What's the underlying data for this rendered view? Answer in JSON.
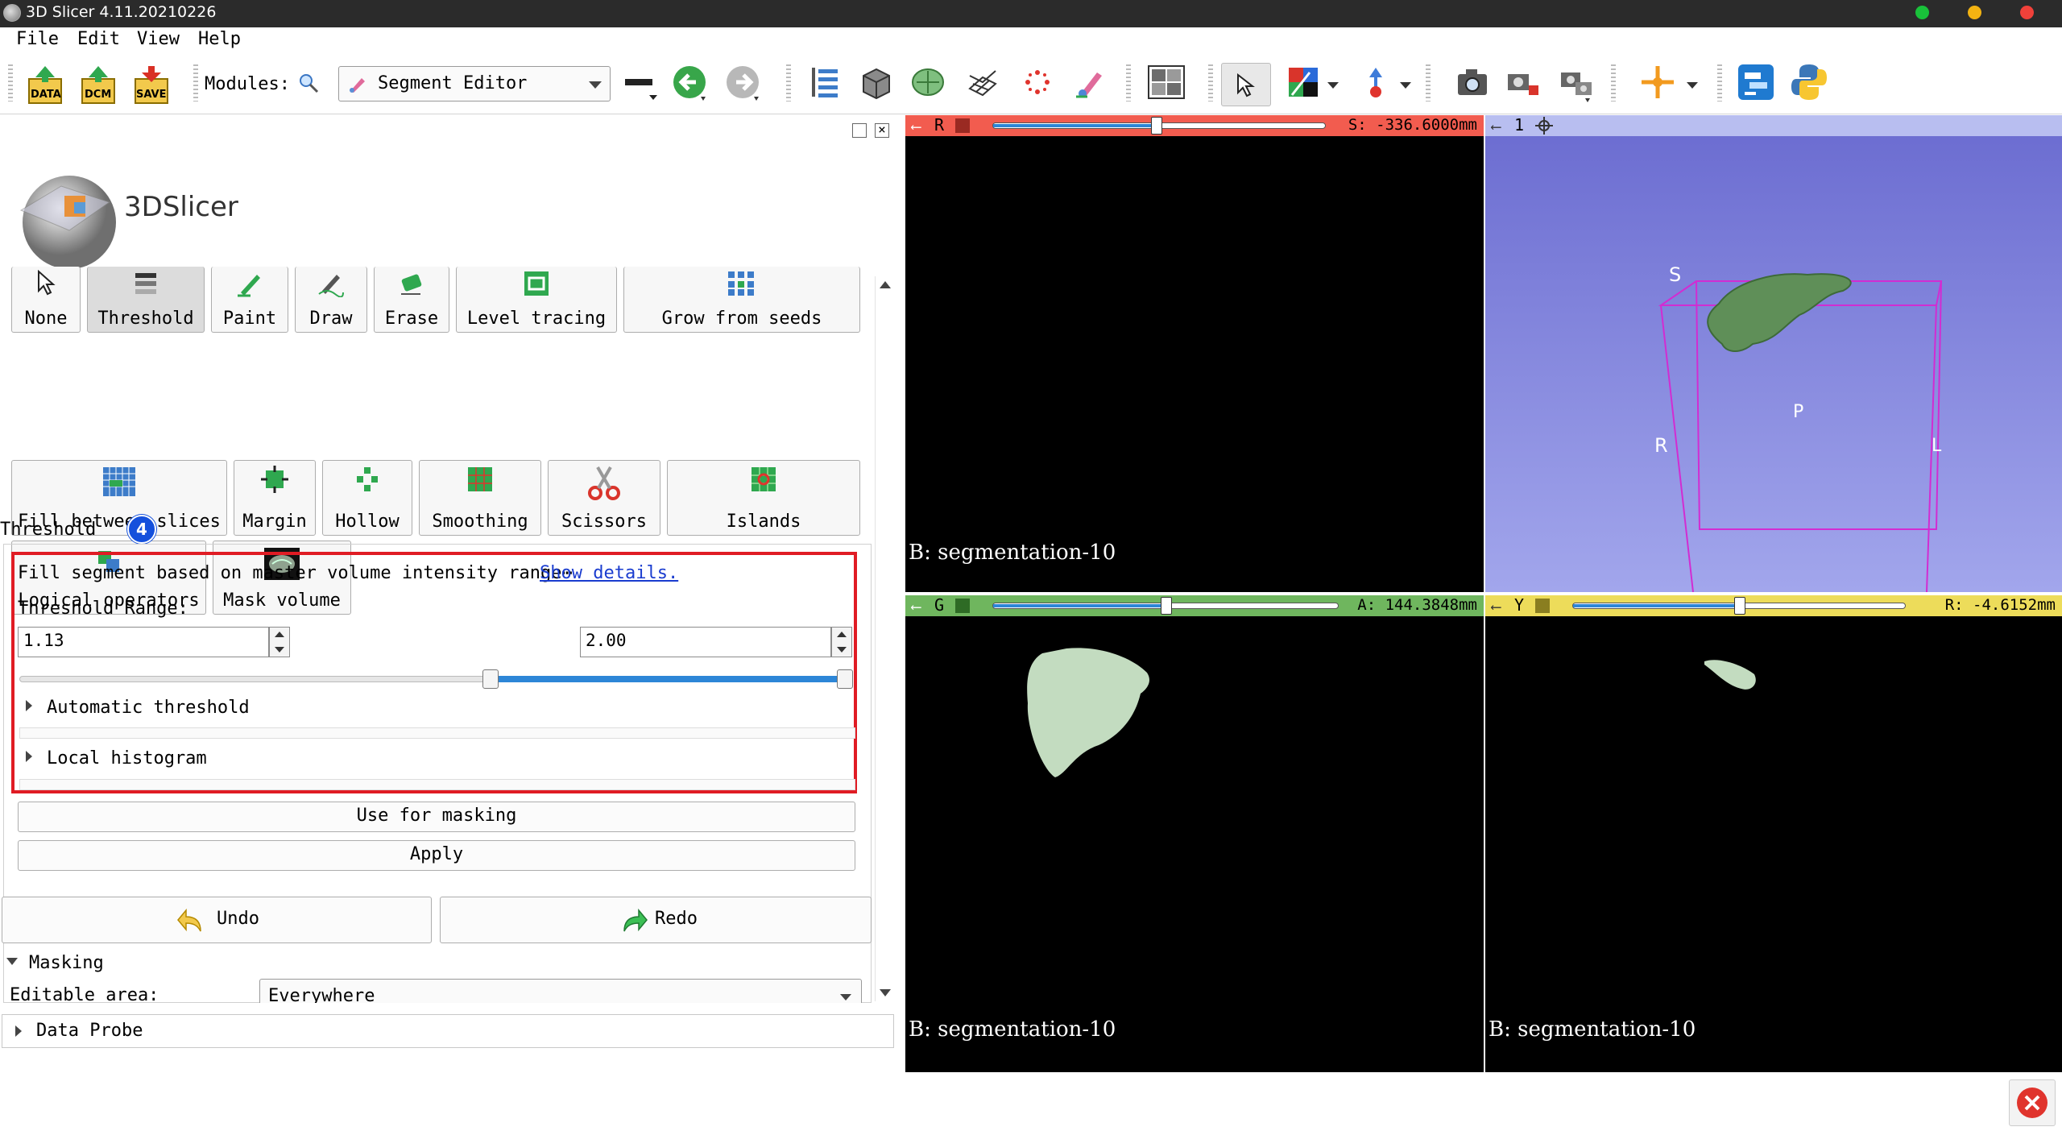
{
  "window": {
    "title": "3D Slicer 4.11.20210226"
  },
  "menu": [
    "File",
    "Edit",
    "View",
    "Help"
  ],
  "toolbar": {
    "data_label": "DATA",
    "dcm_label": "DCM",
    "save_label": "SAVE",
    "modules_label": "Modules:",
    "module_selected": "Segment Editor"
  },
  "logo_text": "3DSlicer",
  "effects": {
    "row1": [
      "None",
      "Threshold",
      "Paint",
      "Draw",
      "Erase",
      "Level tracing",
      "Grow from seeds"
    ],
    "row2": [
      "Fill between slices",
      "Margin",
      "Hollow",
      "Smoothing",
      "Scissors",
      "Islands"
    ],
    "row3": [
      "Logical operators",
      "Mask volume"
    ]
  },
  "threshold": {
    "section_title": "Threshold",
    "step_badge": "4",
    "description": "Fill segment based on master volume intensity range⋯",
    "details_link": "Show details.",
    "range_label": "Threshold Range:",
    "min_value": "1.13",
    "max_value": "2.00",
    "automatic": "Automatic threshold",
    "histogram": "Local histogram",
    "use_for_masking": "Use for masking",
    "apply": "Apply"
  },
  "undo_label": "Undo",
  "redo_label": "Redo",
  "masking": {
    "title": "Masking",
    "editable_area_label": "Editable area:",
    "editable_area_value": "Everywhere"
  },
  "data_probe": "Data Probe",
  "views": {
    "red": {
      "letter": "R",
      "offset": "S: -336.6000mm",
      "slider_fraction": 0.5,
      "label": "B: segmentation-10",
      "color": "#f25c4f"
    },
    "three_d": {
      "id": "1",
      "orient_S": "S",
      "orient_P": "P",
      "orient_R": "R",
      "orient_L": "L"
    },
    "green": {
      "letter": "G",
      "offset": "A: 144.3848mm",
      "slider_fraction": 0.51,
      "label": "B: segmentation-10",
      "color": "#6fb65e"
    },
    "yellow": {
      "letter": "Y",
      "offset": "R: -4.6152mm",
      "slider_fraction": 0.5,
      "label": "B: segmentation-10",
      "color": "#eddc5a"
    }
  }
}
